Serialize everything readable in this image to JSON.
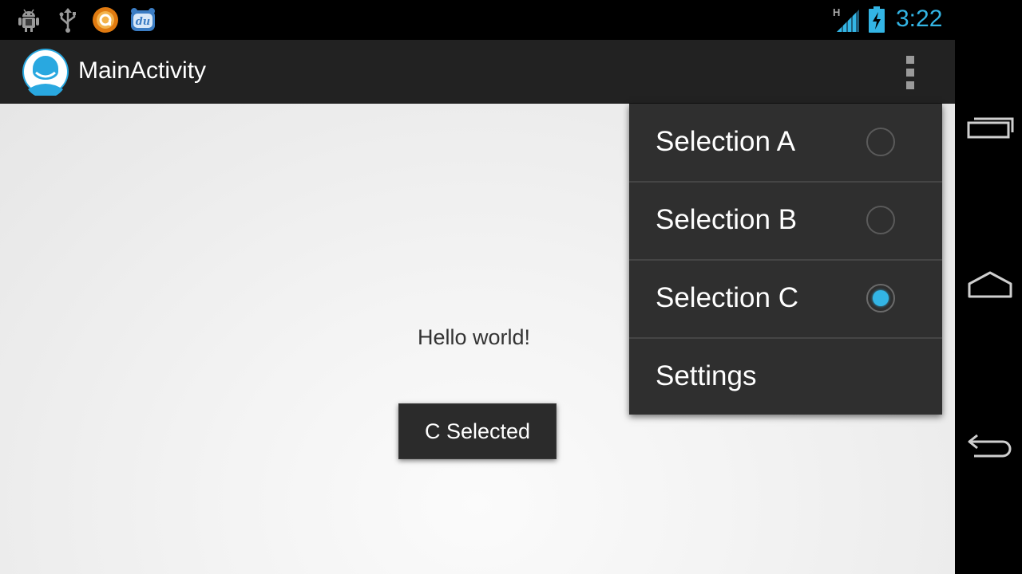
{
  "status_bar": {
    "time": "3:22",
    "network_type": "H",
    "accent_color": "#33b5e5",
    "notification_icons": [
      "android-debug-icon",
      "usb-icon",
      "orange-app-icon",
      "du-app-icon"
    ]
  },
  "action_bar": {
    "title": "MainActivity",
    "app_icon": "app-avatar-icon",
    "overflow_icon": "overflow-menu-icon"
  },
  "content": {
    "hello_text": "Hello world!",
    "toast_text": "C Selected"
  },
  "menu": {
    "items": [
      {
        "label": "Selection A",
        "type": "radio",
        "checked": false
      },
      {
        "label": "Selection B",
        "type": "radio",
        "checked": false
      },
      {
        "label": "Selection C",
        "type": "radio",
        "checked": true
      },
      {
        "label": "Settings",
        "type": "item"
      }
    ]
  },
  "nav_bar": {
    "buttons": [
      "recent-apps-icon",
      "home-icon",
      "back-icon"
    ]
  }
}
